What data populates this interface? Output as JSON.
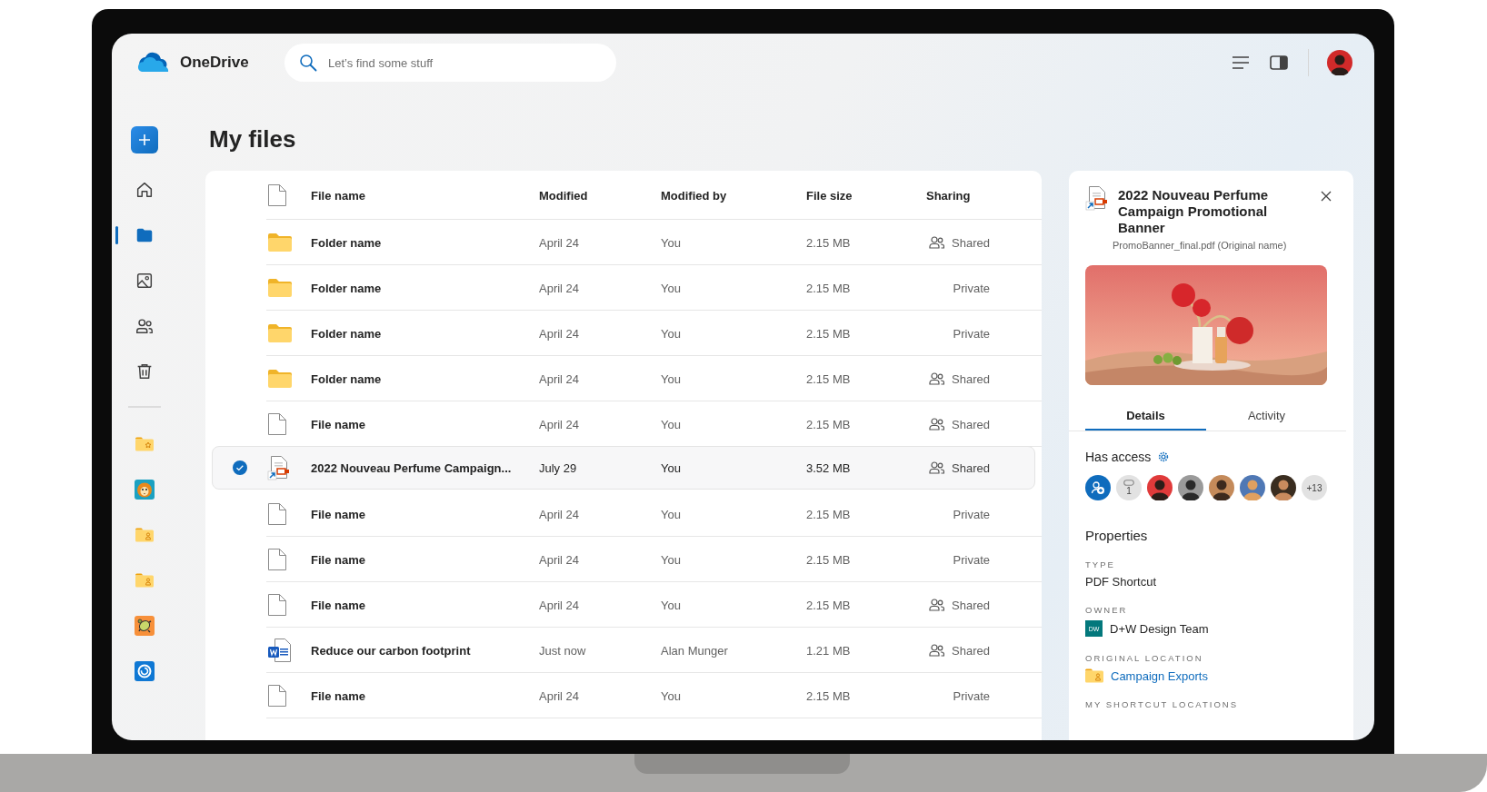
{
  "app": {
    "name": "OneDrive"
  },
  "search": {
    "placeholder": "Let’s find some stuff"
  },
  "nav": [
    {
      "selected": false
    },
    {
      "selected": true
    },
    {
      "selected": false
    },
    {
      "selected": false
    },
    {
      "selected": false
    }
  ],
  "page_title": "My files",
  "table": {
    "columns": [
      "File name",
      "Modified",
      "Modified by",
      "File size",
      "Sharing"
    ],
    "rows": [
      {
        "kind": "folder",
        "name": "Folder name",
        "modified": "April 24",
        "modified_by": "You",
        "size": "2.15 MB",
        "sharing": "Shared",
        "shared": true,
        "selected": false
      },
      {
        "kind": "folder",
        "name": "Folder name",
        "modified": "April 24",
        "modified_by": "You",
        "size": "2.15 MB",
        "sharing": "Private",
        "shared": false,
        "selected": false
      },
      {
        "kind": "folder",
        "name": "Folder name",
        "modified": "April 24",
        "modified_by": "You",
        "size": "2.15 MB",
        "sharing": "Private",
        "shared": false,
        "selected": false
      },
      {
        "kind": "folder",
        "name": "Folder name",
        "modified": "April 24",
        "modified_by": "You",
        "size": "2.15 MB",
        "sharing": "Shared",
        "shared": true,
        "selected": false
      },
      {
        "kind": "file",
        "name": "File name",
        "modified": "April 24",
        "modified_by": "You",
        "size": "2.15 MB",
        "sharing": "Shared",
        "shared": true,
        "selected": false
      },
      {
        "kind": "pdf-shortcut",
        "name": "2022 Nouveau Perfume Campaign...",
        "modified": "July 29",
        "modified_by": "You",
        "size": "3.52 MB",
        "sharing": "Shared",
        "shared": true,
        "selected": true
      },
      {
        "kind": "file",
        "name": "File name",
        "modified": "April 24",
        "modified_by": "You",
        "size": "2.15 MB",
        "sharing": "Private",
        "shared": false,
        "selected": false
      },
      {
        "kind": "file",
        "name": "File name",
        "modified": "April 24",
        "modified_by": "You",
        "size": "2.15 MB",
        "sharing": "Private",
        "shared": false,
        "selected": false
      },
      {
        "kind": "file",
        "name": "File name",
        "modified": "April 24",
        "modified_by": "You",
        "size": "2.15 MB",
        "sharing": "Shared",
        "shared": true,
        "selected": false
      },
      {
        "kind": "word",
        "name": "Reduce our carbon footprint",
        "modified": "Just now",
        "modified_by": "Alan Munger",
        "size": "1.21 MB",
        "sharing": "Shared",
        "shared": true,
        "selected": false
      },
      {
        "kind": "file",
        "name": "File name",
        "modified": "April 24",
        "modified_by": "You",
        "size": "2.15 MB",
        "sharing": "Private",
        "shared": false,
        "selected": false
      }
    ]
  },
  "details": {
    "title": "2022 Nouveau Perfume Campaign Promotional Banner",
    "subtitle": "PromoBanner_final.pdf (Original name)",
    "tabs": [
      {
        "label": "Details",
        "selected": true
      },
      {
        "label": "Activity",
        "selected": false
      }
    ],
    "access": {
      "heading": "Has access",
      "link_count": "1",
      "more": "+13"
    },
    "properties": {
      "heading": "Properties",
      "fields": [
        {
          "kind": "text",
          "label": "TYPE",
          "value": "PDF Shortcut"
        },
        {
          "kind": "owner",
          "label": "OWNER",
          "badge": "DW",
          "value": "D+W Design Team"
        },
        {
          "kind": "link",
          "label": "ORIGINAL LOCATION",
          "value": "Campaign Exports"
        },
        {
          "kind": "empty",
          "label": "MY SHORTCUT LOCATIONS"
        }
      ]
    }
  }
}
